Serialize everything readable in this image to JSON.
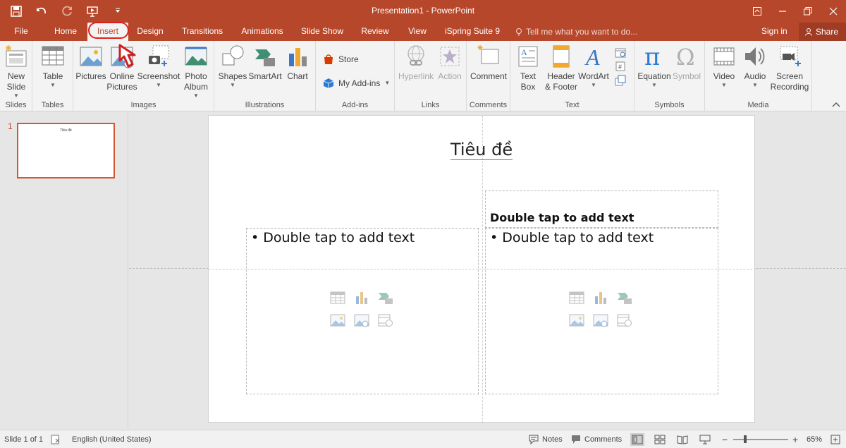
{
  "window": {
    "title": "Presentation1 - PowerPoint",
    "accent_color": "#b7472a"
  },
  "quick_access": [
    {
      "name": "save-icon"
    },
    {
      "name": "undo-icon"
    },
    {
      "name": "redo-icon"
    },
    {
      "name": "start-from-beginning-icon"
    },
    {
      "name": "customize-qat-icon"
    }
  ],
  "tabs": [
    {
      "label": "File"
    },
    {
      "label": "Home"
    },
    {
      "label": "Insert",
      "active": true
    },
    {
      "label": "Design"
    },
    {
      "label": "Transitions"
    },
    {
      "label": "Animations"
    },
    {
      "label": "Slide Show"
    },
    {
      "label": "Review"
    },
    {
      "label": "View"
    },
    {
      "label": "iSpring Suite 9"
    }
  ],
  "tell_me": "Tell me what you want to do...",
  "sign_in": "Sign in",
  "share": "Share",
  "ribbon": {
    "slides": {
      "label": "Slides",
      "new_slide": "New",
      "new_slide_2": "Slide"
    },
    "tables": {
      "label": "Tables",
      "table": "Table"
    },
    "images": {
      "label": "Images",
      "pictures": "Pictures",
      "online_pictures": "Online",
      "online_pictures_2": "Pictures",
      "screenshot": "Screenshot",
      "photo_album": "Photo",
      "photo_album_2": "Album"
    },
    "illustrations": {
      "label": "Illustrations",
      "shapes": "Shapes",
      "smartart": "SmartArt",
      "chart": "Chart"
    },
    "addins": {
      "label": "Add-ins",
      "store": "Store",
      "my_addins": "My Add-ins"
    },
    "links": {
      "label": "Links",
      "hyperlink": "Hyperlink",
      "action": "Action"
    },
    "comments": {
      "label": "Comments",
      "comment": "Comment"
    },
    "text": {
      "label": "Text",
      "text_box": "Text",
      "text_box_2": "Box",
      "header_footer": "Header",
      "header_footer_2": "& Footer",
      "wordart": "WordArt"
    },
    "symbols": {
      "label": "Symbols",
      "equation": "Equation",
      "symbol": "Symbol"
    },
    "media": {
      "label": "Media",
      "video": "Video",
      "audio": "Audio",
      "screen_recording": "Screen",
      "screen_recording_2": "Recording"
    }
  },
  "thumbnails": [
    {
      "number": "1",
      "title": "Tiêu đề"
    }
  ],
  "slide": {
    "title": "Tiêu đề",
    "left_placeholder": "• Double tap to add text",
    "right_heading": "Double tap to add text",
    "right_placeholder": "• Double tap to add text"
  },
  "status": {
    "slide_count": "Slide 1 of 1",
    "language": "English (United States)",
    "notes": "Notes",
    "comments": "Comments",
    "zoom": "65%"
  }
}
